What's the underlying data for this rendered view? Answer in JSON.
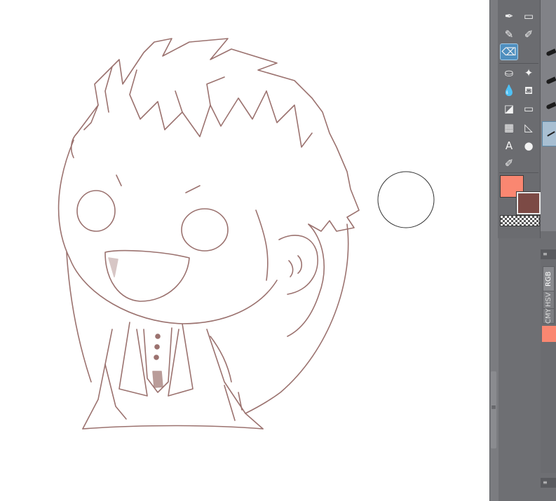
{
  "app": {
    "tools": [
      {
        "name": "pen-tool-icon",
        "glyph": "✒"
      },
      {
        "name": "marker-tool-icon",
        "glyph": "▭"
      },
      {
        "name": "pencil-tool-icon",
        "glyph": "✎"
      },
      {
        "name": "brush-tool-icon",
        "glyph": "🖌"
      },
      {
        "name": "eraser-tool-icon",
        "glyph": "⌫"
      },
      {
        "name": "fill-tool-icon",
        "glyph": "⛀"
      },
      {
        "name": "blend-tool-icon",
        "glyph": "✦"
      },
      {
        "name": "dropper-tool-icon",
        "glyph": "💧"
      },
      {
        "name": "bucket-tool-icon",
        "glyph": "🪣"
      },
      {
        "name": "gradient-tool-icon",
        "glyph": "◪"
      },
      {
        "name": "figure-tool-icon",
        "glyph": "▭"
      },
      {
        "name": "frame-tool-icon",
        "glyph": "▦"
      },
      {
        "name": "ruler-tool-icon",
        "glyph": "◺"
      },
      {
        "name": "text-tool-icon",
        "glyph": "A"
      },
      {
        "name": "balloon-tool-icon",
        "glyph": "💬"
      },
      {
        "name": "correct-line-tool-icon",
        "glyph": "✐"
      }
    ],
    "colors": {
      "main": "#fa8771",
      "sub": "#7c4a45",
      "sketch_line": "#8a5a56"
    },
    "color_tabs": [
      "RGB",
      "HSV",
      "CMY"
    ]
  }
}
